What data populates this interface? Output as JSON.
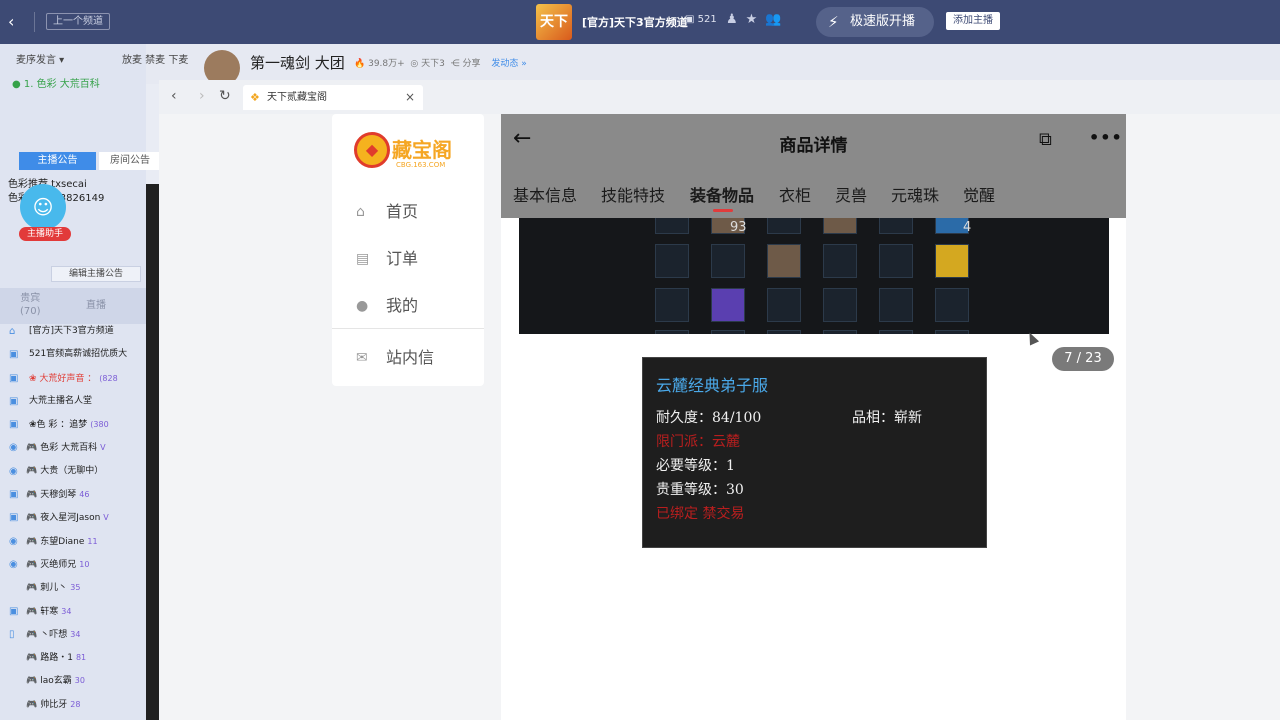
{
  "topbar": {
    "prev_channel": "上一个频道",
    "channel_logo_text": "天下",
    "channel_title": "[官方]天下3官方频道",
    "channel_count": "521",
    "fast_start_label": "极速版开播",
    "add_host_label": "添加主播"
  },
  "stream": {
    "streamer_name": "第一魂剑 大团",
    "heat": "39.8万+",
    "game": "天下3",
    "share": "分享",
    "follow": "发动态 »"
  },
  "left": {
    "speak_mode": "麦序发言",
    "speak_controls": "放麦 禁麦 下麦",
    "rank1": "1. 色彩 大荒百科",
    "notice_tab_host": "主播公告",
    "notice_tab_room": "房间公告",
    "notice_line1": "色彩推荐 txsecai",
    "notice_line2": "色彩 9933 3826149",
    "helper_badge": "主播助手",
    "edit_notice": "编辑主播公告",
    "guests_label": "贵宾",
    "guests_count": "(70)",
    "live_label": "直播",
    "viewers": [
      {
        "name": "[官方]天下3官方频道",
        "lv": ""
      },
      {
        "name": "521官频高薪诚招优质大",
        "lv": ""
      },
      {
        "name": "❀ 大荒好声音 ：",
        "lv": "(828"
      },
      {
        "name": "大荒主播名人堂",
        "lv": ""
      },
      {
        "name": "❀色 彩 ：追梦",
        "lv": "(380"
      },
      {
        "name": "色彩 大荒百科",
        "lv": "V"
      },
      {
        "name": "大贵（无聊中）",
        "lv": ""
      },
      {
        "name": "天穆剑琴",
        "lv": "46"
      },
      {
        "name": "夜入星河Jason",
        "lv": "V"
      },
      {
        "name": "东望Diane",
        "lv": "11"
      },
      {
        "name": "灭绝师兄",
        "lv": "10"
      },
      {
        "name": "刺儿丶",
        "lv": "35"
      },
      {
        "name": "轩寒",
        "lv": "34"
      },
      {
        "name": "丶吓想",
        "lv": "34"
      },
      {
        "name": "路路・1",
        "lv": "81"
      },
      {
        "name": "lao玄霸",
        "lv": "30"
      },
      {
        "name": "帅比牙",
        "lv": "28"
      }
    ]
  },
  "browser": {
    "tab_title": "天下贰藏宝阁",
    "tab_close": "×"
  },
  "site": {
    "brand": "藏宝阁",
    "domain": "CBG.163.COM",
    "nav": [
      {
        "label": "首页",
        "icon": "home-icon"
      },
      {
        "label": "订单",
        "icon": "order-icon"
      },
      {
        "label": "我的",
        "icon": "user-icon"
      },
      {
        "label": "站内信",
        "icon": "mail-icon"
      }
    ]
  },
  "detail": {
    "title": "商品详情",
    "tabs": [
      "基本信息",
      "技能特技",
      "装备物品",
      "衣柜",
      "灵兽",
      "元魂珠",
      "觉醒"
    ],
    "active_tab": "装备物品",
    "slot_num_1": "93",
    "slot_num_2": "4",
    "pager": "7 / 23"
  },
  "item_tooltip": {
    "name": "云麓经典弟子服",
    "durability": "耐久度：84/100",
    "condition": "品相：崭新",
    "school_req": "限门派：云麓",
    "level_req": "必要等级：1",
    "value_level": "贵重等级：30",
    "bind": "已绑定 禁交易"
  },
  "colors": {
    "topbar": "#3d4a74",
    "accent_blue": "#3f8ce8",
    "item_name": "#4aa8e8",
    "item_red": "#b81e1e"
  }
}
